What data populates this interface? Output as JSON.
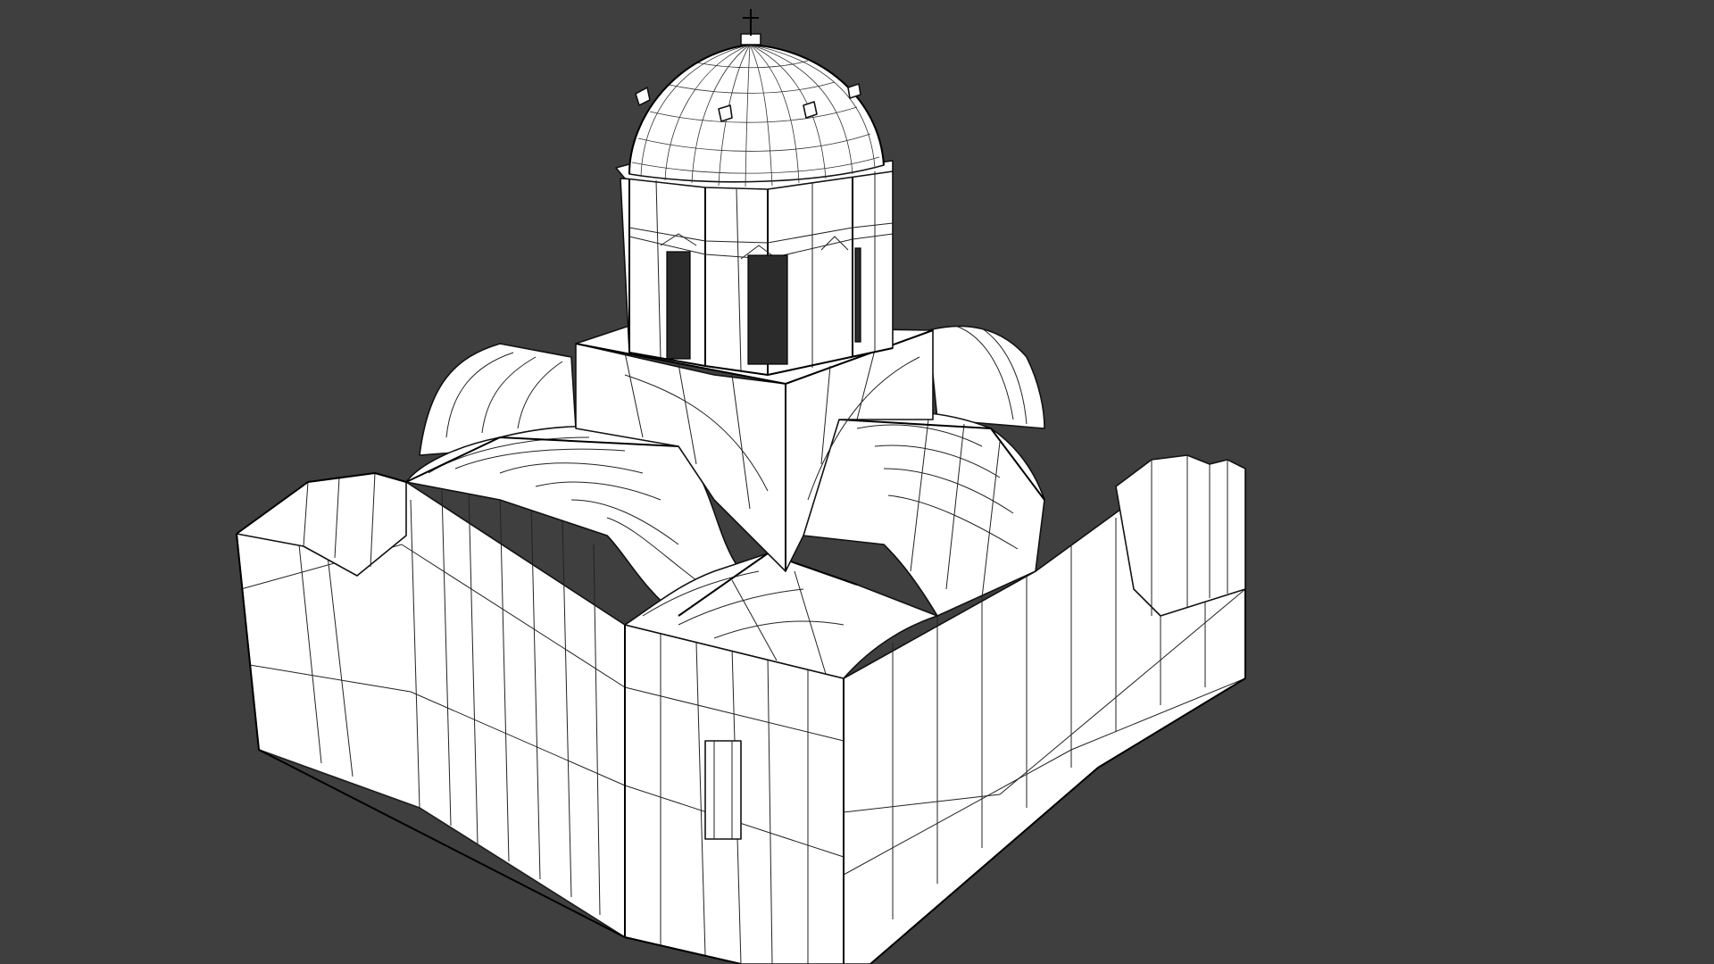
{
  "viewport": {
    "background_color": "#3f3f3f",
    "model_fill_color": "#ffffff",
    "wire_color": "#111111"
  },
  "model": {
    "render_mode": "wireframe-on-shaded",
    "icon": "church-model-icon"
  }
}
